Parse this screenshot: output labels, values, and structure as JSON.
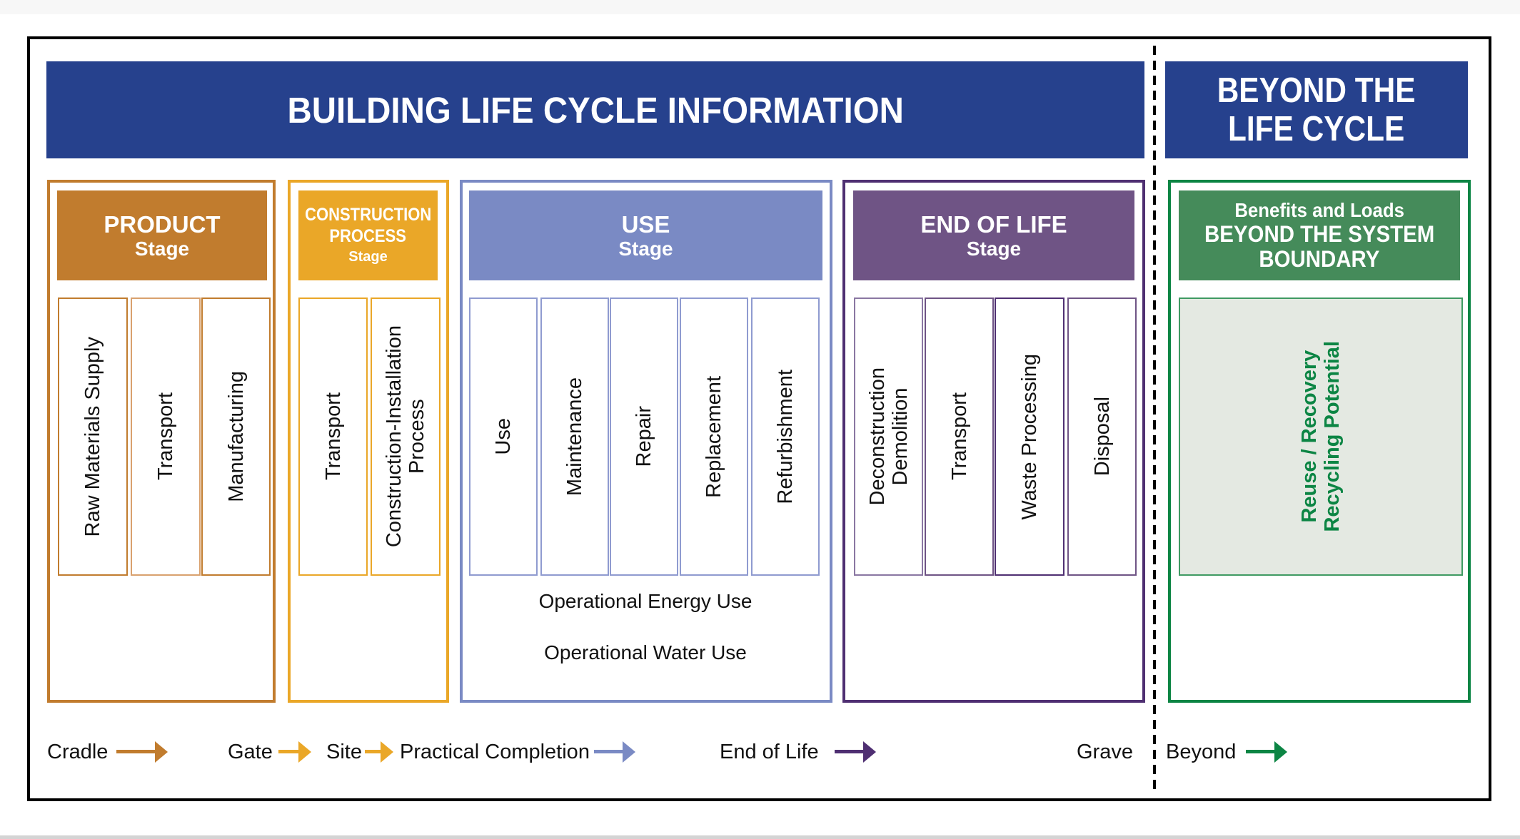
{
  "colors": {
    "header_blue": "#26418d",
    "product": "#c17c2e",
    "construction": "#eaa728",
    "use": "#7a8ac4",
    "end_of_life": "#6f5485",
    "end_of_life_border": "#4f2f72",
    "beyond": "#458b5a",
    "beyond_border": "#0c8544",
    "beyond_panel_bg": "#e4e9e2",
    "beyond_text": "#0c8544"
  },
  "header": {
    "title": "BUILDING LIFE CYCLE INFORMATION",
    "beyond_title_line1": "BEYOND THE",
    "beyond_title_line2": "LIFE CYCLE"
  },
  "stages": {
    "product": {
      "title": "PRODUCT",
      "subtitle": "Stage",
      "modules": [
        "Raw Materials Supply",
        "Transport",
        "Manufacturing"
      ]
    },
    "construction": {
      "title_line1": "CONSTRUCTION",
      "title_line2": "PROCESS",
      "subtitle": "Stage",
      "modules": [
        "Transport",
        "Construction-Installation\nProcess"
      ]
    },
    "use": {
      "title": "USE",
      "subtitle": "Stage",
      "modules": [
        "Use",
        "Maintenance",
        "Repair",
        "Replacement",
        "Refurbishment"
      ],
      "operational": [
        "Operational Energy Use",
        "Operational Water Use"
      ]
    },
    "end_of_life": {
      "title": "END OF LIFE",
      "subtitle": "Stage",
      "modules": [
        "Deconstruction\nDemolition",
        "Transport",
        "Waste Processing",
        "Disposal"
      ]
    },
    "beyond": {
      "title_line1": "Benefits and Loads",
      "title_line2": "BEYOND THE SYSTEM",
      "title_line3": "BOUNDARY",
      "module": "Reuse / Recovery\nRecycling Potential"
    }
  },
  "legend": {
    "cradle": "Cradle",
    "gate": "Gate",
    "site": "Site",
    "practical_completion": "Practical Completion",
    "end_of_life": "End of Life",
    "grave": "Grave",
    "beyond": "Beyond",
    "arrow_icon": "right-arrow-icon"
  }
}
